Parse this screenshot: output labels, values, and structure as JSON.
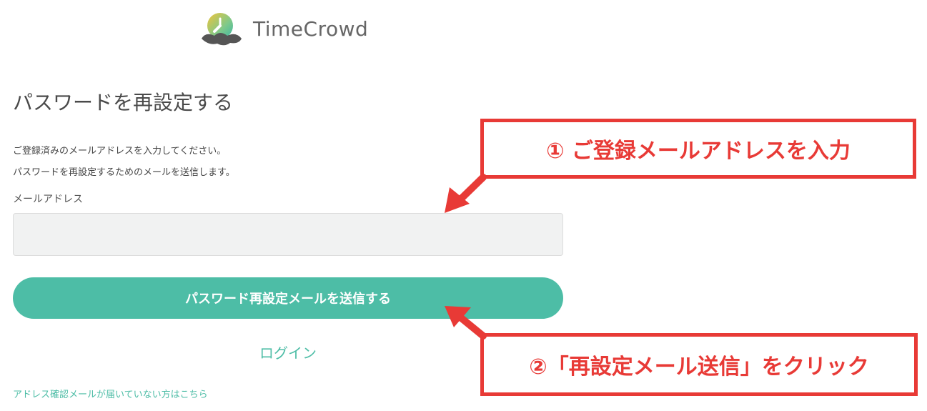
{
  "brand": {
    "name": "TimeCrowd",
    "logo_icon": "clock-cloud-icon",
    "logo_colors": [
      "#4dbda6",
      "#f0c43a",
      "#555555"
    ]
  },
  "form": {
    "title": "パスワードを再設定する",
    "description_line1": "ご登録済みのメールアドレスを入力してください。",
    "description_line2": "パスワードを再設定するためのメールを送信します。",
    "email_label": "メールアドレス",
    "email_value": "",
    "submit_label": "パスワード再設定メールを送信する",
    "login_link": "ログイン",
    "confirm_link": "アドレス確認メールが届いていない方はこちら"
  },
  "annotations": {
    "step1": "① ご登録メールアドレスを入力",
    "step2": "②「再設定メール送信」をクリック",
    "color": "#e83a36"
  },
  "colors": {
    "accent": "#4dbda6",
    "input_bg": "#f1f2f2",
    "annotation": "#e83a36"
  }
}
